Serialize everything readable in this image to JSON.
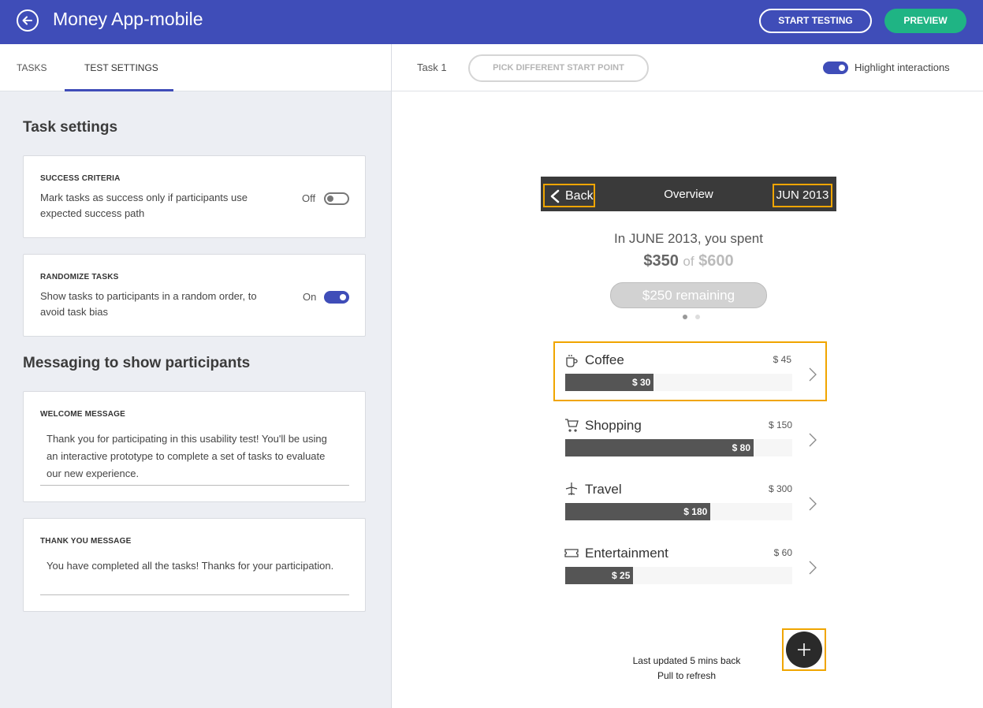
{
  "header": {
    "title": "Money App-mobile",
    "start_testing": "START TESTING",
    "preview": "PREVIEW"
  },
  "tabs": {
    "tasks": "TASKS",
    "test_settings": "TEST SETTINGS"
  },
  "task_settings": {
    "title": "Task settings",
    "success_criteria": {
      "label": "SUCCESS CRITERIA",
      "text": "Mark tasks as success only if participants use expected success path",
      "state": "Off"
    },
    "randomize": {
      "label": "RANDOMIZE TASKS",
      "text": "Show tasks to participants in a random order, to avoid task bias",
      "state": "On"
    }
  },
  "messaging": {
    "title": "Messaging to show participants",
    "welcome": {
      "label": "WELCOME MESSAGE",
      "text": "Thank you for participating in this usability test! You'll be using an interactive prototype to complete a set of tasks to evaluate our new experience."
    },
    "thank_you": {
      "label": "THANK YOU MESSAGE",
      "text": "You have completed all the tasks! Thanks for your participation."
    }
  },
  "preview_header": {
    "task": "Task 1",
    "pick_start": "PICK DIFFERENT START POINT",
    "highlight": "Highlight interactions"
  },
  "phone": {
    "back": "Back",
    "title": "Overview",
    "date": "JUN 2013",
    "spent_line": "In JUNE 2013, you spent",
    "spent": "$350",
    "of": "of",
    "budget": "$600",
    "remaining": "$250 remaining",
    "categories": [
      {
        "name": "Coffee",
        "total": "$ 45",
        "spent": "$ 30",
        "fraction": 0.39,
        "icon": "coffee-icon"
      },
      {
        "name": "Shopping",
        "total": "$ 150",
        "spent": "$ 80",
        "fraction": 0.83,
        "icon": "cart-icon"
      },
      {
        "name": "Travel",
        "total": "$ 300",
        "spent": "$ 180",
        "fraction": 0.64,
        "icon": "plane-icon"
      },
      {
        "name": "Entertainment",
        "total": "$ 60",
        "spent": "$ 25",
        "fraction": 0.3,
        "icon": "ticket-icon"
      }
    ],
    "updated": "Last updated 5 mins back",
    "refresh": "Pull to refresh"
  },
  "colors": {
    "brand": "#3f4db8",
    "preview_button": "#1fb484",
    "highlight": "#f0a500"
  }
}
